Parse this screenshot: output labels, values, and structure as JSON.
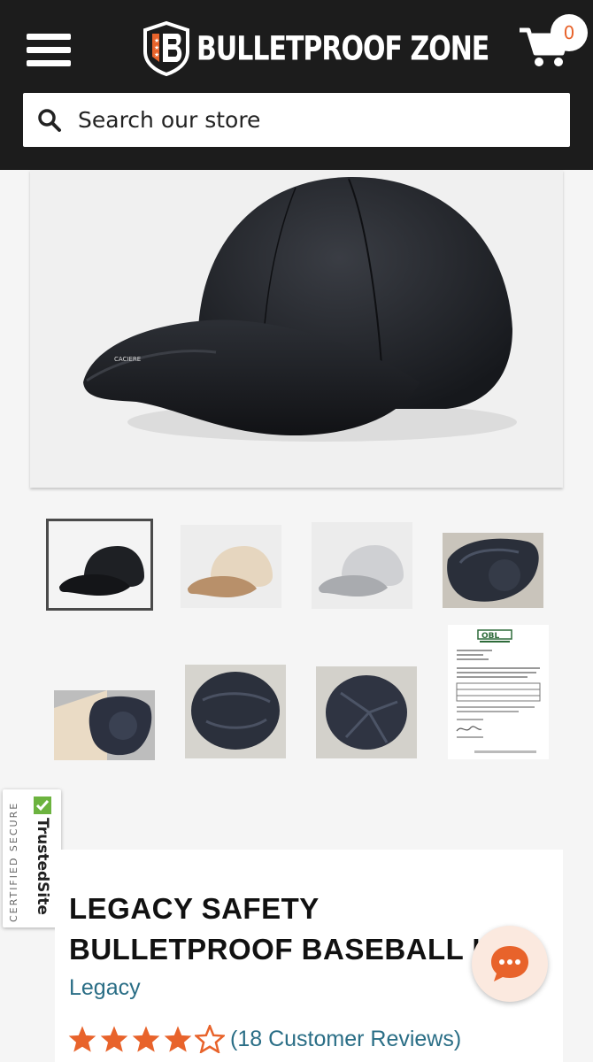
{
  "header": {
    "brand_name": "BULLETPROOF ZONE",
    "cart_count": "0",
    "search_placeholder": "Search our store"
  },
  "gallery": {
    "main_image": "black-baseball-cap-photo",
    "thumbnails": [
      {
        "name": "black-cap-thumbnail",
        "selected": true
      },
      {
        "name": "beige-cap-thumbnail",
        "selected": false
      },
      {
        "name": "grey-cap-thumbnail",
        "selected": false
      },
      {
        "name": "cap-underside-thumbnail",
        "selected": false
      },
      {
        "name": "beige-cap-inside-thumbnail",
        "selected": false
      },
      {
        "name": "ballistic-insert-thumbnail",
        "selected": false
      },
      {
        "name": "ballistic-insert-alt-thumbnail",
        "selected": false
      },
      {
        "name": "certificate-document-thumbnail",
        "selected": false
      }
    ],
    "certificate_logo_text": "OBL"
  },
  "trust_badge": {
    "brand": "TrustedSite",
    "caption": "CERTIFIED SECURE"
  },
  "product": {
    "title_line1": "LEGACY SAFETY",
    "title_line2": "BULLETPROOF BASEBALL HAT",
    "vendor": "Legacy",
    "rating": 4,
    "rating_max": 5,
    "reviews_text": "(18 Customer Reviews)"
  },
  "colors": {
    "header_bg": "#1c1c1c",
    "accent_orange": "#e8632b",
    "link_teal": "#2a6e86",
    "trusted_green": "#6cb33f"
  },
  "icons": {
    "menu": "hamburger-icon",
    "cart": "cart-icon",
    "search": "search-icon",
    "chat": "chat-bubble-icon",
    "star": "star-icon"
  }
}
